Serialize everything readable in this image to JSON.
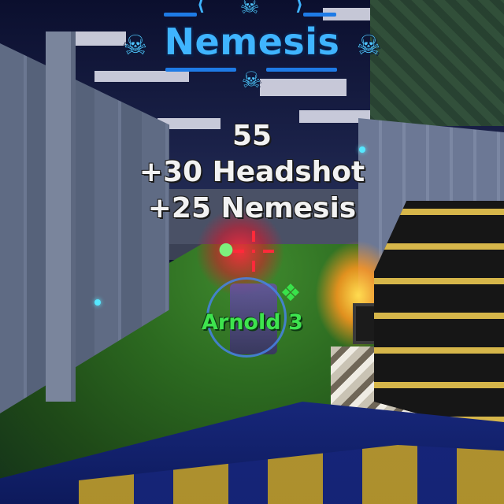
{
  "hud": {
    "banner": {
      "title": "Nemesis",
      "icons": [
        "skull-icon",
        "skull-icon",
        "skull-icon",
        "skull-icon"
      ],
      "accent_color": "#3fb4ff"
    },
    "score_popup": {
      "total": "55",
      "bonuses": [
        "+30 Headshot",
        "+25 Nemesis"
      ],
      "text_color": "#f2f2f2"
    },
    "crosshair": {
      "color": "#ff2a3a"
    },
    "target": {
      "name": "Arnold 3",
      "name_color": "#3ee44e",
      "clan_icon": "paw-icon"
    }
  }
}
